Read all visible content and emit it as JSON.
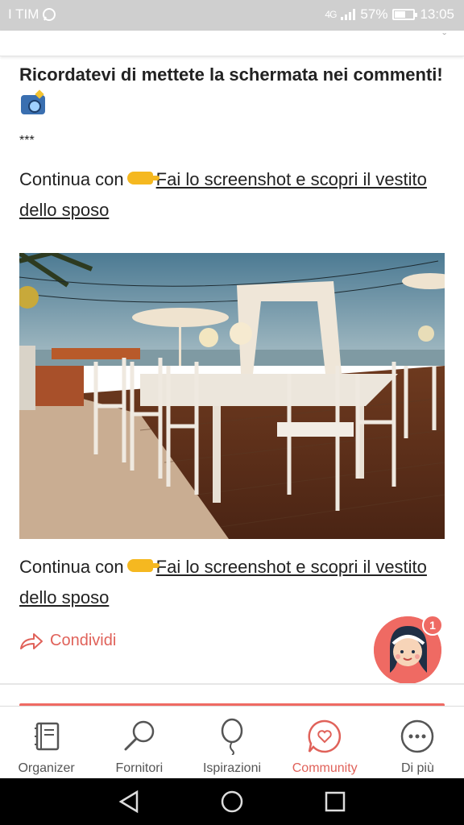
{
  "status_bar": {
    "carrier": "I TIM",
    "network": "4G",
    "battery": "57%",
    "time": "13:05"
  },
  "post": {
    "paragraph1": "Ricordatevi di mettete la schermata nei commenti!",
    "separator": "***",
    "continue1_prefix": "Continua con",
    "continue1_link": "Fai lo screenshot e scopri il vestito dello sposo",
    "continue2_prefix": "Continua con",
    "continue2_link": "Fai lo screenshot e scopri il vestito dello sposo"
  },
  "actions": {
    "share_label": "Condividi",
    "notification_count": "1"
  },
  "bottom_nav": {
    "items": [
      {
        "label": "Organizer",
        "icon": "organizer-icon"
      },
      {
        "label": "Fornitori",
        "icon": "search-icon"
      },
      {
        "label": "Ispirazioni",
        "icon": "balloon-icon"
      },
      {
        "label": "Community",
        "icon": "heart-chat-icon",
        "active": true
      },
      {
        "label": "Di più",
        "icon": "more-icon"
      }
    ]
  },
  "colors": {
    "accent": "#e0625a",
    "status_bar": "#cfcfcf"
  }
}
